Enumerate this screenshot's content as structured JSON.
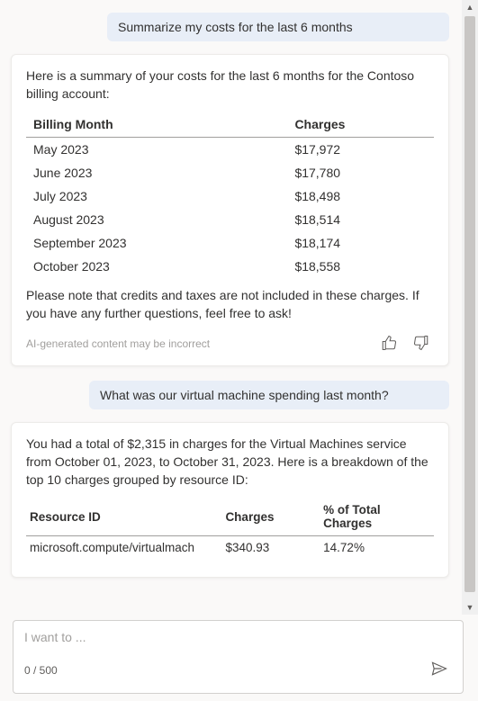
{
  "user1": "Summarize my costs for the last 6 months",
  "card1": {
    "intro": "Here is a summary of your costs for the last 6 months for the Contoso billing account:",
    "col1": "Billing Month",
    "col2": "Charges",
    "rows": [
      {
        "month": "May 2023",
        "charge": "$17,972"
      },
      {
        "month": "June 2023",
        "charge": "$17,780"
      },
      {
        "month": "July 2023",
        "charge": "$18,498"
      },
      {
        "month": "August 2023",
        "charge": "$18,514"
      },
      {
        "month": "September 2023",
        "charge": "$18,174"
      },
      {
        "month": "October 2023",
        "charge": "$18,558"
      }
    ],
    "outro": "Please note that credits and taxes are not included in these charges. If you have any further questions, feel free to ask!",
    "disclaimer": "AI-generated content may be incorrect"
  },
  "user2": "What was our virtual machine spending last month?",
  "card2": {
    "intro": "You had a total of $2,315 in charges for the Virtual Machines service from October 01, 2023, to October 31, 2023. Here is a breakdown of the top 10 charges grouped by resource ID:",
    "col1": "Resource ID",
    "col2": "Charges",
    "col3": "% of Total Charges",
    "rows": [
      {
        "id": "microsoft.compute/virtualmach",
        "charge": "$340.93",
        "pct": "14.72%"
      }
    ]
  },
  "input": {
    "placeholder": "I want to ...",
    "counter": "0 / 500"
  },
  "chart_data": [
    {
      "type": "table",
      "title": "Costs for the last 6 months — Contoso billing account",
      "columns": [
        "Billing Month",
        "Charges (USD)"
      ],
      "categories": [
        "May 2023",
        "June 2023",
        "July 2023",
        "August 2023",
        "September 2023",
        "October 2023"
      ],
      "values": [
        17972,
        17780,
        18498,
        18514,
        18174,
        18558
      ]
    },
    {
      "type": "table",
      "title": "Virtual Machines spending Oct 2023 — top charges by resource ID (partial)",
      "total": 2315,
      "columns": [
        "Resource ID",
        "Charges (USD)",
        "% of Total Charges"
      ],
      "rows": [
        {
          "id": "microsoft.compute/virtualmach",
          "charge": 340.93,
          "pct": 14.72
        }
      ]
    }
  ]
}
